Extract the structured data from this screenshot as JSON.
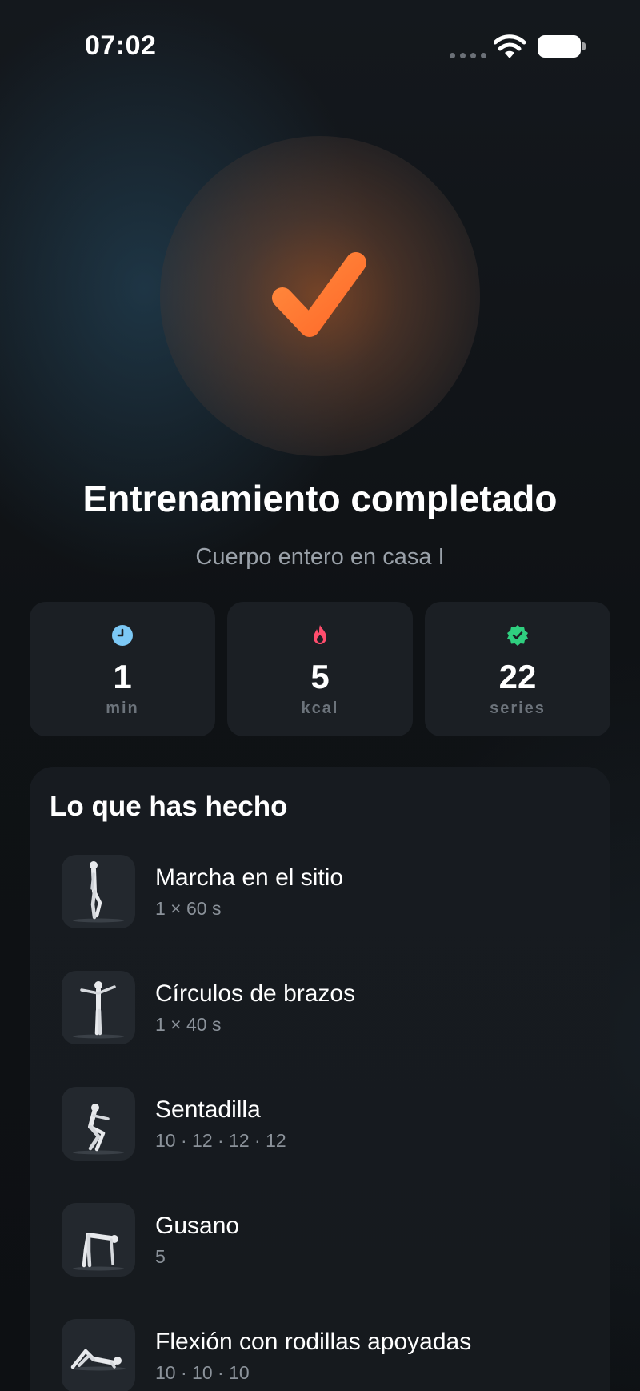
{
  "status_bar": {
    "time": "07:02"
  },
  "hero": {
    "icon": "check-icon",
    "title": "Entrenamiento completado",
    "subtitle": "Cuerpo entero en casa I"
  },
  "stats": [
    {
      "icon": "clock-icon",
      "color": "#7cc8f5",
      "value": "1",
      "unit": "min"
    },
    {
      "icon": "flame-icon",
      "color": "#ff4d6d",
      "value": "5",
      "unit": "kcal"
    },
    {
      "icon": "verified-badge-icon",
      "color": "#2fcf7f",
      "value": "22",
      "unit": "series"
    }
  ],
  "summary": {
    "title": "Lo que has hecho",
    "exercises": [
      {
        "name": "Marcha en el sitio",
        "detail": "1 × 60 s",
        "icon": "march-figure-icon"
      },
      {
        "name": "Círculos de brazos",
        "detail": "1 × 40 s",
        "icon": "arm-circles-figure-icon"
      },
      {
        "name": "Sentadilla",
        "detail": "10 · 12 · 12 · 12",
        "icon": "squat-figure-icon"
      },
      {
        "name": "Gusano",
        "detail": "5",
        "icon": "inchworm-figure-icon"
      },
      {
        "name": "Flexión con rodillas apoyadas",
        "detail": "10 · 10 · 10",
        "icon": "knee-pushup-figure-icon"
      }
    ]
  },
  "colors": {
    "accent": "#ff7a3d",
    "background": "#0e1114",
    "card": "#1b1f24"
  }
}
